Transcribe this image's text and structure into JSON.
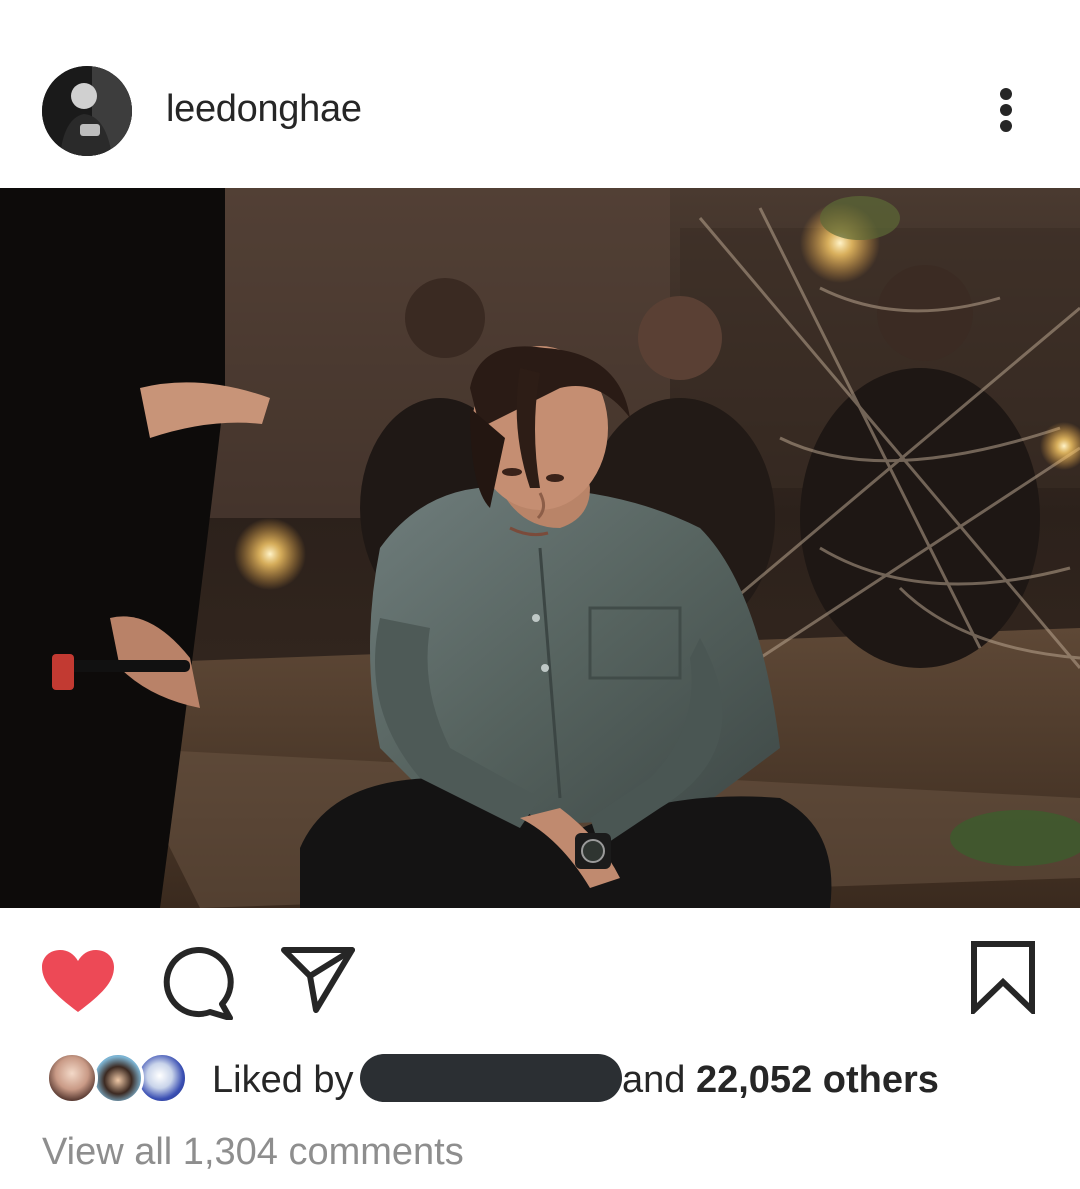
{
  "post": {
    "username": "leedonghae",
    "likes": {
      "liked_by_label": "Liked by",
      "and_label": "and",
      "others_label": "22,052 others"
    },
    "view_comments_label": "View all 1,304 comments"
  },
  "colors": {
    "like_active": "#ed4956",
    "text_primary": "#262626",
    "text_secondary": "#8e8e8e",
    "redaction": "#2b2f33"
  },
  "icons": {
    "more": "more-vertical-icon",
    "like": "heart-filled-icon",
    "comment": "comment-bubble-icon",
    "share": "paper-plane-icon",
    "save": "bookmark-icon"
  }
}
